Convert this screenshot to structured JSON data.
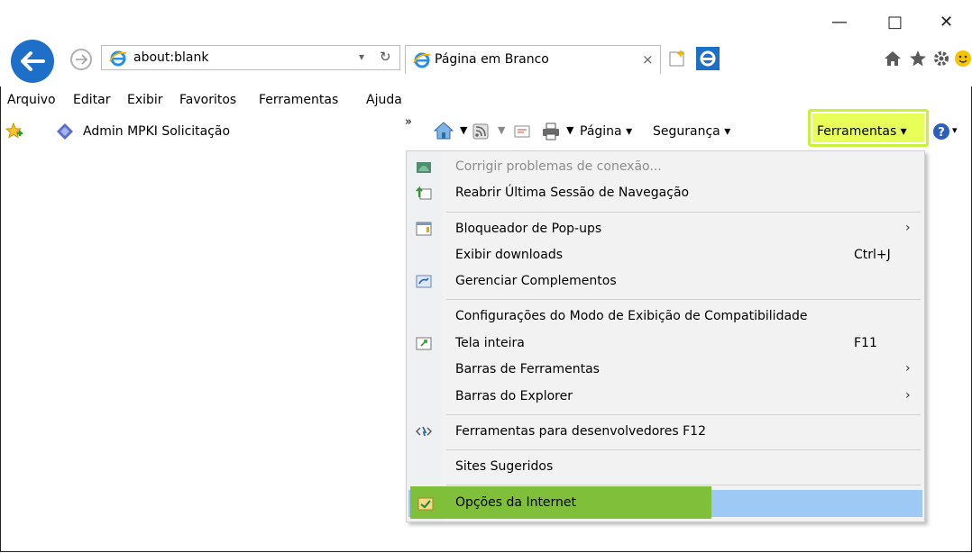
{
  "window": {
    "minimize": "—",
    "maximize": "□",
    "close": "✕"
  },
  "address_bar": {
    "url": "about:blank",
    "dropdown": "▾",
    "refresh": "↻"
  },
  "tab": {
    "title": "Página em Branco",
    "close": "×"
  },
  "menubar": {
    "items": [
      "Arquivo",
      "Editar",
      "Exibir",
      "Favoritos",
      "Ferramentas",
      "Ajuda"
    ]
  },
  "favorites": {
    "item": "Admin MPKI Solicitação",
    "chevron": "»"
  },
  "commandbar": {
    "page": "Página ▾",
    "security": "Segurança ▾",
    "tools": "Ferramentas ▾",
    "help_arrow": "▾"
  },
  "tools_menu": {
    "items": [
      {
        "label": "Corrigir problemas de conexão...",
        "accel": "",
        "submenu": false,
        "disabled": true
      },
      {
        "label": "Reabrir Última Sessão de Navegação",
        "accel": "",
        "submenu": false,
        "disabled": false
      },
      {
        "label": "Bloqueador de Pop-ups",
        "accel": "",
        "submenu": true,
        "disabled": false
      },
      {
        "label": "Exibir downloads",
        "accel": "Ctrl+J",
        "submenu": false,
        "disabled": false
      },
      {
        "label": "Gerenciar Complementos",
        "accel": "",
        "submenu": false,
        "disabled": false
      },
      {
        "label": "Configurações do Modo de Exibição de Compatibilidade",
        "accel": "",
        "submenu": false,
        "disabled": false
      },
      {
        "label": "Tela inteira",
        "accel": "F11",
        "submenu": false,
        "disabled": false
      },
      {
        "label": "Barras de Ferramentas",
        "accel": "",
        "submenu": true,
        "disabled": false
      },
      {
        "label": "Barras do Explorer",
        "accel": "",
        "submenu": true,
        "disabled": false
      },
      {
        "label": "Ferramentas para desenvolvedores F12",
        "accel": "",
        "submenu": false,
        "disabled": false
      },
      {
        "label": "Sites Sugeridos",
        "accel": "",
        "submenu": false,
        "disabled": false
      },
      {
        "label": "Opções da Internet",
        "accel": "",
        "submenu": false,
        "disabled": false,
        "highlighted": true
      }
    ],
    "submenu_arrow": "›"
  },
  "colors": {
    "highlight_yellow": "#e8ff5a",
    "hover_blue": "#9ec9f4",
    "ie_blue": "#1e6fc8"
  }
}
